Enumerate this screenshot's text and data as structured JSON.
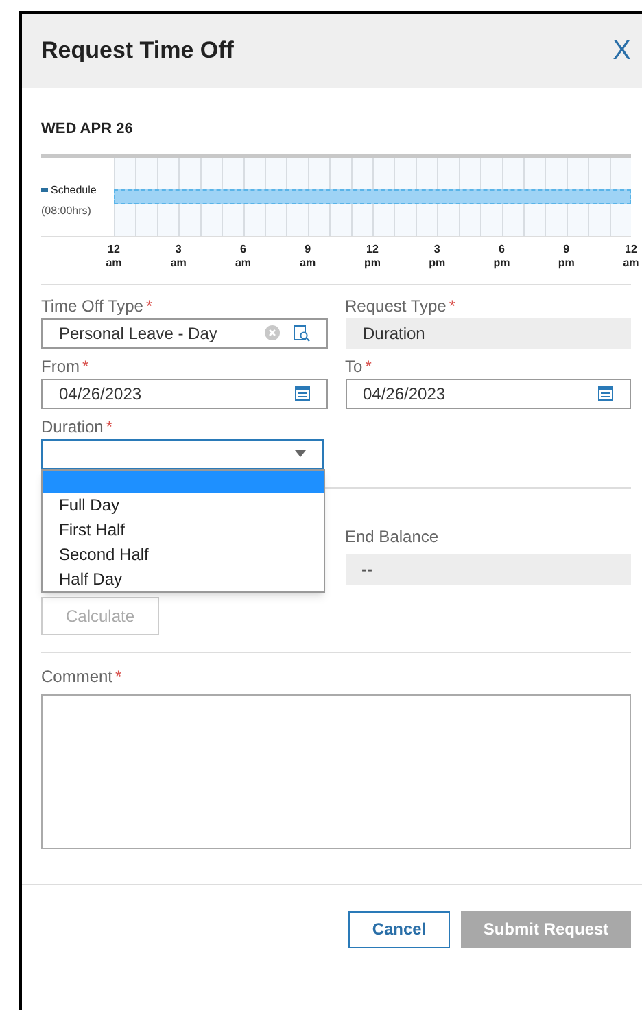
{
  "dialog": {
    "title": "Request Time Off",
    "close": "X"
  },
  "schedule": {
    "date": "WED APR 26",
    "legend": "Schedule",
    "hours": "(08:00hrs)",
    "ticks": [
      {
        "hour": "12",
        "period": "am"
      },
      {
        "hour": "3",
        "period": "am"
      },
      {
        "hour": "6",
        "period": "am"
      },
      {
        "hour": "9",
        "period": "am"
      },
      {
        "hour": "12",
        "period": "pm"
      },
      {
        "hour": "3",
        "period": "pm"
      },
      {
        "hour": "6",
        "period": "pm"
      },
      {
        "hour": "9",
        "period": "pm"
      },
      {
        "hour": "12",
        "period": "am"
      }
    ]
  },
  "required_mark": "*",
  "fields": [
    {
      "label": "Time Off Type",
      "required": true,
      "value": "Personal Leave - Day",
      "kind": "lookup",
      "disabled": false
    },
    {
      "label": "Request Type",
      "required": true,
      "value": "Duration",
      "kind": "text",
      "disabled": true
    },
    {
      "label": "From",
      "required": true,
      "value": "04/26/2023",
      "kind": "date",
      "disabled": false
    },
    {
      "label": "To",
      "required": true,
      "value": "04/26/2023",
      "kind": "date",
      "disabled": false
    }
  ],
  "duration": {
    "label": "Duration",
    "required": true,
    "blank_highlighted": true,
    "options": [
      {
        "label": "Full Day",
        "selected": false
      },
      {
        "label": "First Half",
        "selected": false
      },
      {
        "label": "Second Half",
        "selected": false
      },
      {
        "label": "Half Day",
        "selected": false
      }
    ]
  },
  "end_balance": {
    "label": "End Balance",
    "value": "--",
    "disabled": true
  },
  "calculate": {
    "label": "Calculate",
    "disabled": true
  },
  "comment": {
    "label": "Comment",
    "required": true
  },
  "buttons": [
    {
      "label": "Cancel",
      "kind": "secondary",
      "disabled": false
    },
    {
      "label": "Submit Request",
      "kind": "primary",
      "disabled": true
    }
  ]
}
